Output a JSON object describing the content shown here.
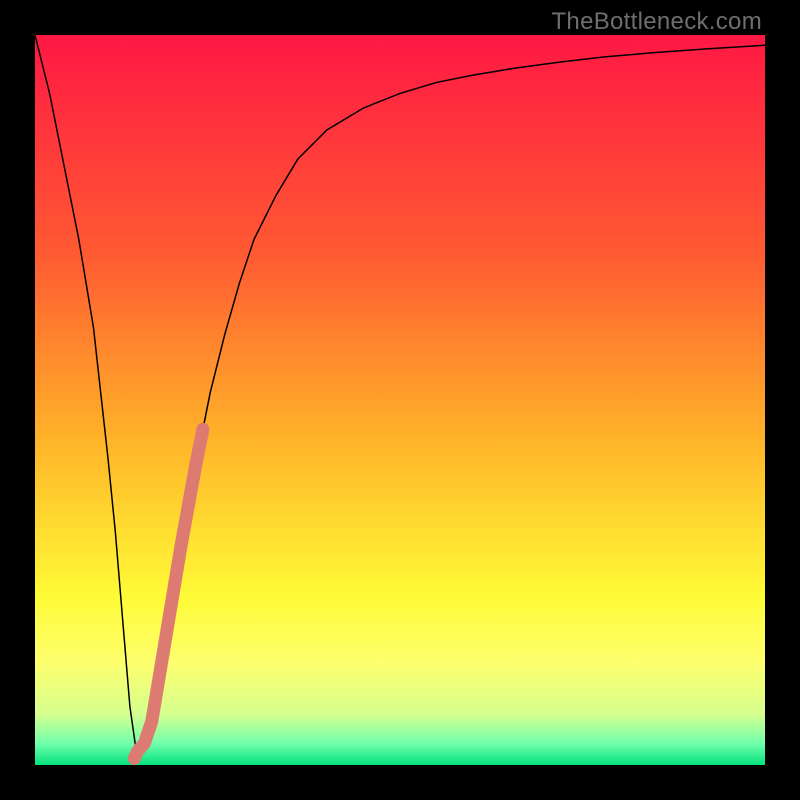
{
  "watermark": "TheBottleneck.com",
  "chart_data": {
    "type": "line",
    "title": "",
    "xlabel": "",
    "ylabel": "",
    "xlim": [
      0,
      100
    ],
    "ylim": [
      0,
      100
    ],
    "background_gradient": [
      {
        "pos": 0.0,
        "color": "#ff1844"
      },
      {
        "pos": 0.3,
        "color": "#ff5a32"
      },
      {
        "pos": 0.55,
        "color": "#ffb229"
      },
      {
        "pos": 0.77,
        "color": "#fffb37"
      },
      {
        "pos": 0.86,
        "color": "#fdff6e"
      },
      {
        "pos": 0.93,
        "color": "#d6ff8e"
      },
      {
        "pos": 0.97,
        "color": "#73ffac"
      },
      {
        "pos": 1.0,
        "color": "#04e27e"
      }
    ],
    "series": [
      {
        "name": "bottleneck-curve",
        "color": "#000000",
        "stroke_width": 1.5,
        "x": [
          0,
          2,
          4,
          6,
          8,
          10,
          11,
          12,
          13,
          14,
          15,
          16,
          18,
          20,
          22,
          24,
          26,
          28,
          30,
          33,
          36,
          40,
          45,
          50,
          55,
          60,
          66,
          72,
          78,
          85,
          92,
          100
        ],
        "y": [
          100,
          92,
          82,
          72,
          60,
          42,
          32,
          20,
          8,
          1,
          2,
          6,
          18,
          30,
          41,
          51,
          59,
          66,
          72,
          78,
          83,
          87,
          90,
          92,
          93.5,
          94.5,
          95.5,
          96.3,
          97.0,
          97.6,
          98.1,
          98.6
        ]
      },
      {
        "name": "highlight-segment",
        "color": "#dd7b72",
        "stroke_width": 13,
        "linecap": "round",
        "x": [
          14.3,
          15.0,
          15.5,
          16.0,
          17.0,
          18.0,
          19.0,
          20.0,
          21.0,
          22.0,
          23.0
        ],
        "y": [
          2.2,
          3.0,
          4.5,
          6.0,
          12.0,
          18.0,
          24.0,
          30.0,
          35.5,
          41.0,
          46.0
        ]
      },
      {
        "name": "highlight-dot",
        "color": "#dd7b72",
        "stroke_width": 13,
        "linecap": "round",
        "x": [
          13.6,
          14.0
        ],
        "y": [
          0.9,
          1.8
        ]
      }
    ]
  }
}
